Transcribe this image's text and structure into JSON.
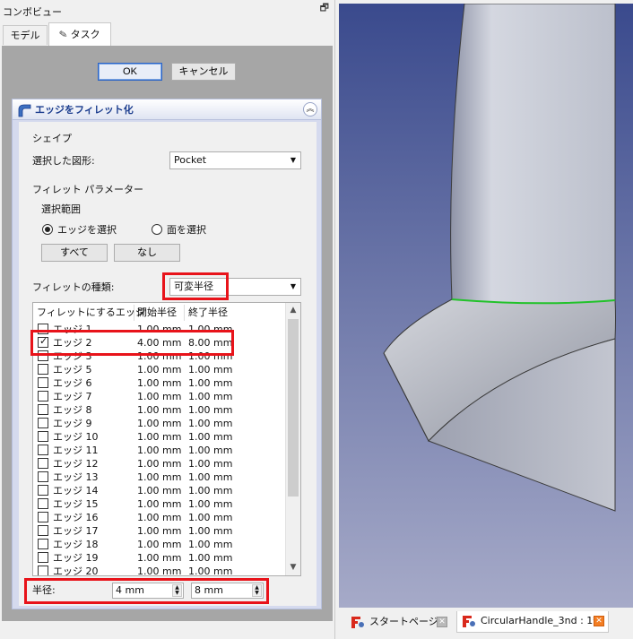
{
  "combo": {
    "title": "コンボビュー",
    "float_icon": "float-icon",
    "tabs": [
      {
        "label": "モデル",
        "active": false
      },
      {
        "label": "タスク",
        "active": true,
        "icon": "pencil-icon"
      }
    ]
  },
  "dialog": {
    "ok_label": "OK",
    "cancel_label": "キャンセル"
  },
  "fillet": {
    "title": "エッジをフィレット化",
    "shape_group": "シェイプ",
    "selected_shape_label": "選択した図形:",
    "selected_shape_value": "Pocket",
    "params_group": "フィレット パラメーター",
    "selection_group": "選択範囲",
    "radio_edges": "エッジを選択",
    "radio_faces": "面を選択",
    "radio_selected": "edges",
    "all_label": "すべて",
    "none_label": "なし",
    "type_label": "フィレットの種類:",
    "type_value": "可変半径",
    "columns": [
      "フィレットにするエッジ",
      "開始半径",
      "終了半径"
    ],
    "rows": [
      {
        "name": "エッジ 1",
        "start": "1.00 mm",
        "end": "1.00 mm",
        "checked": false
      },
      {
        "name": "エッジ 2",
        "start": "4.00 mm",
        "end": "8.00 mm",
        "checked": true
      },
      {
        "name": "エッジ 3",
        "start": "1.00 mm",
        "end": "1.00 mm",
        "checked": false
      },
      {
        "name": "エッジ 5",
        "start": "1.00 mm",
        "end": "1.00 mm",
        "checked": false
      },
      {
        "name": "エッジ 6",
        "start": "1.00 mm",
        "end": "1.00 mm",
        "checked": false
      },
      {
        "name": "エッジ 7",
        "start": "1.00 mm",
        "end": "1.00 mm",
        "checked": false
      },
      {
        "name": "エッジ 8",
        "start": "1.00 mm",
        "end": "1.00 mm",
        "checked": false
      },
      {
        "name": "エッジ 9",
        "start": "1.00 mm",
        "end": "1.00 mm",
        "checked": false
      },
      {
        "name": "エッジ 10",
        "start": "1.00 mm",
        "end": "1.00 mm",
        "checked": false
      },
      {
        "name": "エッジ 11",
        "start": "1.00 mm",
        "end": "1.00 mm",
        "checked": false
      },
      {
        "name": "エッジ 12",
        "start": "1.00 mm",
        "end": "1.00 mm",
        "checked": false
      },
      {
        "name": "エッジ 13",
        "start": "1.00 mm",
        "end": "1.00 mm",
        "checked": false
      },
      {
        "name": "エッジ 14",
        "start": "1.00 mm",
        "end": "1.00 mm",
        "checked": false
      },
      {
        "name": "エッジ 15",
        "start": "1.00 mm",
        "end": "1.00 mm",
        "checked": false
      },
      {
        "name": "エッジ 16",
        "start": "1.00 mm",
        "end": "1.00 mm",
        "checked": false
      },
      {
        "name": "エッジ 17",
        "start": "1.00 mm",
        "end": "1.00 mm",
        "checked": false
      },
      {
        "name": "エッジ 18",
        "start": "1.00 mm",
        "end": "1.00 mm",
        "checked": false
      },
      {
        "name": "エッジ 19",
        "start": "1.00 mm",
        "end": "1.00 mm",
        "checked": false
      },
      {
        "name": "エッジ 20",
        "start": "1.00 mm",
        "end": "1.00 mm",
        "checked": false
      }
    ],
    "radius_label": "半径:",
    "radius_start": "4 mm",
    "radius_end": "8 mm"
  },
  "view": {
    "tabs": [
      {
        "label": "スタートページ",
        "icon": "freecad-icon",
        "active": false
      },
      {
        "label": "CircularHandle_3nd : 1*",
        "icon": "freecad-icon",
        "active": true
      }
    ],
    "edge_highlight_color": "#22c22a",
    "highlight_color": "#e8131a"
  }
}
